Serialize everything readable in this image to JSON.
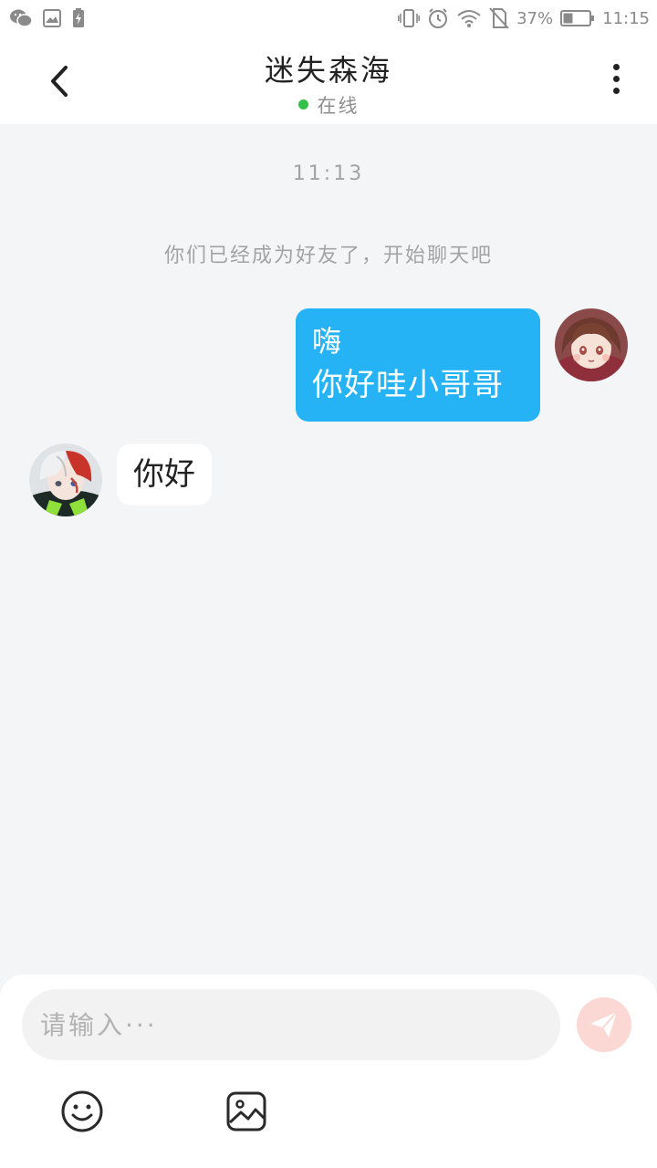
{
  "status_bar": {
    "left_icons": [
      "wechat-icon",
      "image-notification-icon",
      "battery-saver-icon"
    ],
    "battery_percent": "37%",
    "time": "11:15",
    "right_icons": [
      "vibrate-icon",
      "alarm-icon",
      "wifi-icon",
      "no-sim-icon",
      "battery-icon"
    ],
    "battery_level": 0.37
  },
  "header": {
    "title": "迷失森海",
    "status": "在线",
    "status_color": "#35c04a"
  },
  "chat": {
    "timestamp": "11:13",
    "system_message": "你们已经成为好友了，开始聊天吧",
    "messages": [
      {
        "side": "right",
        "lines": [
          "嗨",
          "你好哇小哥哥"
        ],
        "avatar": "girl-avatar"
      },
      {
        "side": "left",
        "lines": [
          "你好"
        ],
        "avatar": "boy-avatar"
      }
    ],
    "outgoing_bubble_color": "#26b3f5"
  },
  "input": {
    "placeholder": "请输入···",
    "value": "",
    "send_icon": "send-icon",
    "toolbar_icons": [
      "emoji-icon",
      "image-icon"
    ]
  }
}
